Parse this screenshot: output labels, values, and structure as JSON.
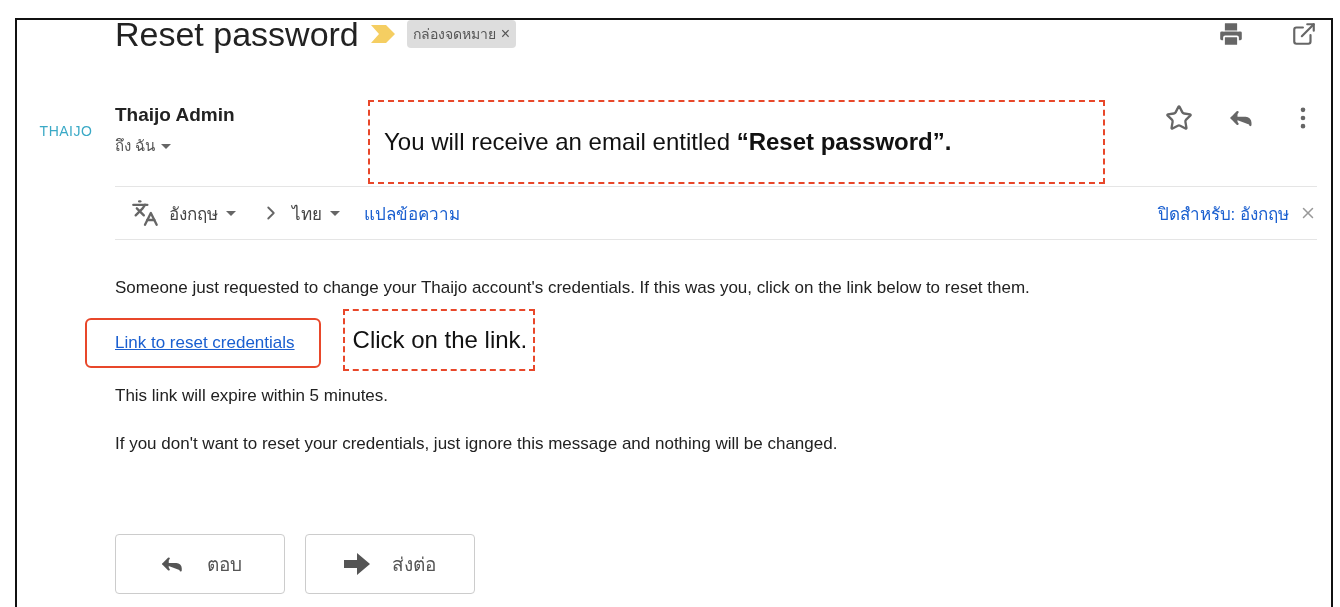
{
  "subject": {
    "title": "Reset password",
    "label_chip": "กล่องจดหมาย",
    "chip_close": "×"
  },
  "sender": {
    "logo_text": "THAIJO",
    "name": "Thaijo Admin",
    "recipient": "ถึง ฉัน"
  },
  "translation_bar": {
    "from_language": "อังกฤษ",
    "to_language": "ไทย",
    "translate_link": "แปลข้อความ",
    "turn_off_link": "ปิดสำหรับ: อังกฤษ"
  },
  "body": {
    "intro": "Someone just requested to change your Thaijo account's credentials. If this was you, click on the link below to reset them.",
    "link": "Link to reset credentials",
    "link_highlighted": true,
    "expiry": "This link will expire within 5 minutes.",
    "ignore_note": "If you don't want to reset your credentials, just ignore this message and nothing will be changed."
  },
  "annotations": [
    {
      "text": "You will receive an email entitled **“Reset password”.**"
    },
    {
      "text": "Click on the link."
    }
  ],
  "buttons": [
    {
      "kind": "reply",
      "label": "ตอบ"
    },
    {
      "kind": "forward",
      "label": "ส่งต่อ"
    }
  ]
}
